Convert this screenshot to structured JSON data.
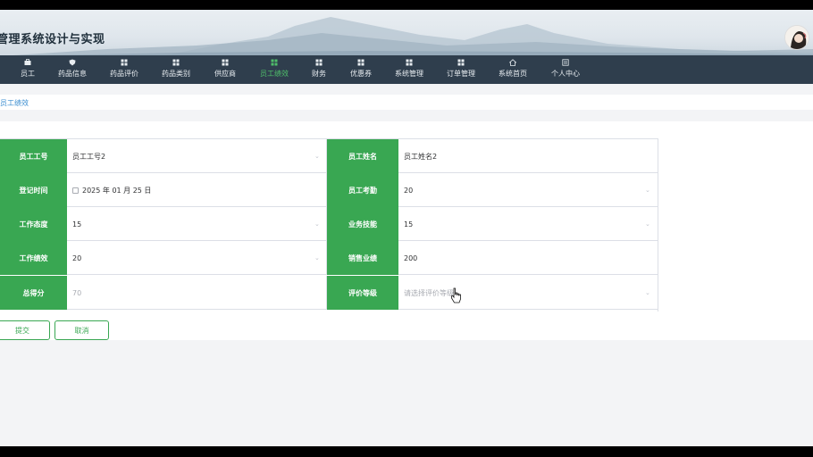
{
  "header": {
    "title": "管理系统设计与实现"
  },
  "nav": {
    "items": [
      {
        "label": "员工",
        "icon": "briefcase-icon"
      },
      {
        "label": "药品信息",
        "icon": "shield-icon"
      },
      {
        "label": "药品评价",
        "icon": "grid-icon"
      },
      {
        "label": "药品类别",
        "icon": "grid-icon"
      },
      {
        "label": "供应商",
        "icon": "grid-icon"
      },
      {
        "label": "员工绩效",
        "icon": "grid-icon",
        "active": true
      },
      {
        "label": "财务",
        "icon": "grid-icon"
      },
      {
        "label": "优惠券",
        "icon": "grid-icon"
      },
      {
        "label": "系统管理",
        "icon": "grid-icon"
      },
      {
        "label": "订单管理",
        "icon": "grid-icon"
      },
      {
        "label": "系统首页",
        "icon": "home-icon"
      },
      {
        "label": "个人中心",
        "icon": "user-card-icon"
      }
    ],
    "active_color": "#4fbf6a",
    "bg_color": "#2f3e4d"
  },
  "breadcrumb": {
    "current": "员工绩效"
  },
  "form": {
    "rows": [
      {
        "left_label": "员工工号",
        "left_value": "员工工号2",
        "right_label": "员工姓名",
        "right_value": "员工姓名2"
      },
      {
        "left_label": "登记时间",
        "left_value": "2025 年 01 月 25 日",
        "right_label": "员工考勤",
        "right_value": "20"
      },
      {
        "left_label": "工作态度",
        "left_value": "15",
        "right_label": "业务技能",
        "right_value": "15"
      },
      {
        "left_label": "工作绩效",
        "left_value": "20",
        "right_label": "销售业绩",
        "right_value": "200"
      },
      {
        "left_label": "总得分",
        "left_value": "70",
        "right_label": "评价等级",
        "right_placeholder": "请选择评价等级"
      }
    ],
    "label_color": "#39a752"
  },
  "actions": {
    "submit_label": "提交",
    "cancel_label": "取消"
  }
}
